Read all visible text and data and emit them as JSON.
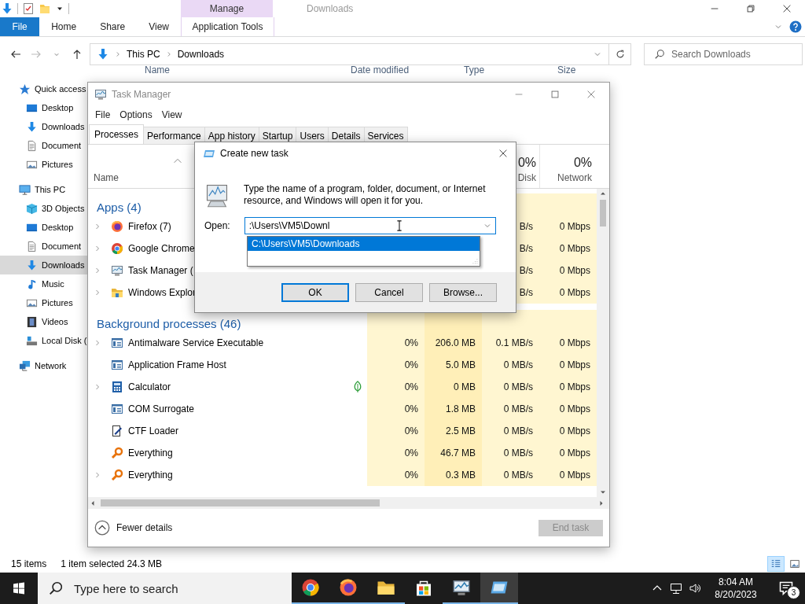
{
  "explorer": {
    "title": "Downloads",
    "ribbon_tabs": [
      {
        "label": "File",
        "kind": "file"
      },
      {
        "label": "Home",
        "kind": "tab"
      },
      {
        "label": "Share",
        "kind": "tab"
      },
      {
        "label": "View",
        "kind": "tab"
      }
    ],
    "context_tab": {
      "group": "Manage",
      "label": "Application Tools"
    },
    "breadcrumb": [
      "This PC",
      "Downloads"
    ],
    "search": {
      "placeholder": "Search Downloads"
    },
    "columns": [
      "Name",
      "Date modified",
      "Type",
      "Size"
    ],
    "nav": [
      {
        "label": "Quick access",
        "kind": "star",
        "selected": false,
        "children": [
          {
            "label": "Desktop",
            "kind": "desktop",
            "selected": false
          },
          {
            "label": "Downloads",
            "kind": "download",
            "selected": false
          },
          {
            "label": "Document",
            "kind": "document",
            "selected": false
          },
          {
            "label": "Pictures",
            "kind": "pictures",
            "selected": false
          }
        ]
      },
      {
        "label": "This PC",
        "kind": "pc",
        "selected": false,
        "children": [
          {
            "label": "3D Objects",
            "kind": "cube",
            "selected": false
          },
          {
            "label": "Desktop",
            "kind": "desktop",
            "selected": false
          },
          {
            "label": "Document",
            "kind": "document",
            "selected": false
          },
          {
            "label": "Downloads",
            "kind": "download",
            "selected": true
          },
          {
            "label": "Music",
            "kind": "music",
            "selected": false
          },
          {
            "label": "Pictures",
            "kind": "pictures",
            "selected": false
          },
          {
            "label": "Videos",
            "kind": "video",
            "selected": false
          },
          {
            "label": "Local Disk (",
            "kind": "disk",
            "selected": false
          }
        ]
      },
      {
        "label": "Network",
        "kind": "network",
        "selected": false
      }
    ],
    "status": {
      "items": "15 items",
      "selection": "1 item selected  24.3 MB"
    },
    "views": [
      {
        "kind": "details",
        "selected": true
      },
      {
        "kind": "large_icons",
        "selected": false
      }
    ]
  },
  "task_manager": {
    "title": "Task Manager",
    "menu": [
      "File",
      "Options",
      "View"
    ],
    "tabs": [
      {
        "label": "Processes",
        "selected": true
      },
      {
        "label": "Performance",
        "selected": false
      },
      {
        "label": "App history",
        "selected": false
      },
      {
        "label": "Startup",
        "selected": false
      },
      {
        "label": "Users",
        "selected": false
      },
      {
        "label": "Details",
        "selected": false
      },
      {
        "label": "Services",
        "selected": false
      }
    ],
    "name_header": "Name",
    "disk_header": {
      "percent": "0%",
      "label": "Disk"
    },
    "network_header": {
      "percent": "0%",
      "label": "Network"
    },
    "groups": [
      {
        "title": "Apps (4)",
        "rows": [
          {
            "name": "Firefox (7)",
            "kind": "firefox",
            "expandable": true,
            "suspended": false,
            "disk": "B/s",
            "network": "0 Mbps"
          },
          {
            "name": "Google Chrome",
            "kind": "chrome",
            "expandable": true,
            "suspended": false,
            "disk": "B/s",
            "network": "0 Mbps"
          },
          {
            "name": "Task Manager (",
            "kind": "taskmgr",
            "expandable": true,
            "suspended": false,
            "disk": "B/s",
            "network": "0 Mbps"
          },
          {
            "name": "Windows Explor",
            "kind": "explorer",
            "expandable": true,
            "suspended": false,
            "disk": "B/s",
            "network": "0 Mbps"
          }
        ]
      },
      {
        "title": "Background processes (46)",
        "rows": [
          {
            "name": "Antimalware Service Executable",
            "kind": "service",
            "expandable": true,
            "suspended": false,
            "cpu": "0%",
            "memory": "206.0 MB",
            "disk": "0.1 MB/s",
            "network": "0 Mbps"
          },
          {
            "name": "Application Frame Host",
            "kind": "service",
            "expandable": false,
            "suspended": false,
            "cpu": "0%",
            "memory": "5.0 MB",
            "disk": "0 MB/s",
            "network": "0 Mbps"
          },
          {
            "name": "Calculator",
            "kind": "calculator",
            "expandable": true,
            "suspended": true,
            "cpu": "0%",
            "memory": "0 MB",
            "disk": "0 MB/s",
            "network": "0 Mbps"
          },
          {
            "name": "COM Surrogate",
            "kind": "service",
            "expandable": false,
            "suspended": false,
            "cpu": "0%",
            "memory": "1.8 MB",
            "disk": "0 MB/s",
            "network": "0 Mbps"
          },
          {
            "name": "CTF Loader",
            "kind": "ctf",
            "expandable": false,
            "suspended": false,
            "cpu": "0%",
            "memory": "2.5 MB",
            "disk": "0 MB/s",
            "network": "0 Mbps"
          },
          {
            "name": "Everything",
            "kind": "everything",
            "expandable": false,
            "suspended": false,
            "cpu": "0%",
            "memory": "46.7 MB",
            "disk": "0 MB/s",
            "network": "0 Mbps"
          },
          {
            "name": "Everything",
            "kind": "everything",
            "expandable": true,
            "suspended": false,
            "cpu": "0%",
            "memory": "0.3 MB",
            "disk": "0 MB/s",
            "network": "0 Mbps"
          }
        ]
      }
    ],
    "footer": {
      "toggle": "Fewer details",
      "end_task": {
        "label": "End task",
        "disabled": true
      }
    }
  },
  "dialog": {
    "title": "Create new task",
    "message": "Type the name of a program, folder, document, or Internet resource, and Windows will open it for you.",
    "open_label": "Open:",
    "value": ":\\Users\\VM5\\Downl",
    "suggestions": [
      {
        "text": "C:\\Users\\VM5\\Downloads",
        "selected": true
      }
    ],
    "buttons": [
      {
        "label": "OK",
        "default": true
      },
      {
        "label": "Cancel",
        "default": false
      },
      {
        "label": "Browse...",
        "default": false
      }
    ]
  },
  "taskbar": {
    "search_placeholder": "Type here to search",
    "apps": [
      {
        "kind": "chrome",
        "running": true,
        "active": false
      },
      {
        "kind": "firefox",
        "running": true,
        "active": false
      },
      {
        "kind": "folder",
        "running": true,
        "active": false
      },
      {
        "kind": "store",
        "running": false,
        "active": false
      },
      {
        "kind": "taskmgr",
        "running": true,
        "active": false
      },
      {
        "kind": "run",
        "running": true,
        "active": true
      }
    ],
    "time": "8:04 AM",
    "date": "8/20/2023",
    "notifications": "3"
  }
}
